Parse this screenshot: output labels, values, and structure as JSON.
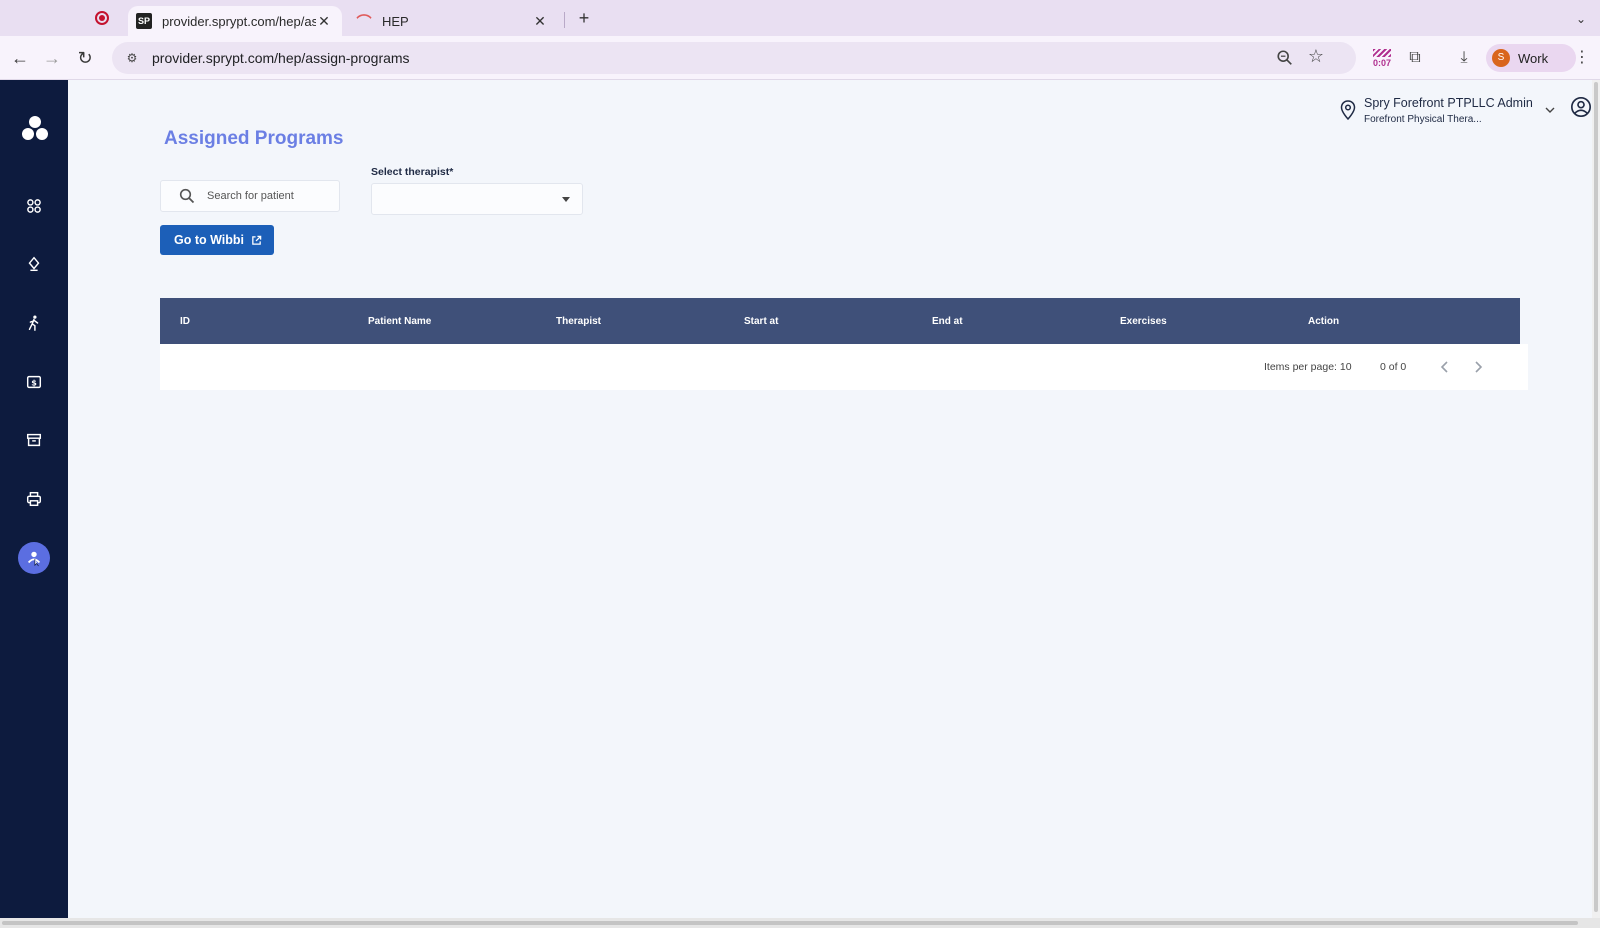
{
  "browser": {
    "tabs": [
      {
        "title": "provider.sprypt.com/hep/assi",
        "favicon": "spry-logo-icon",
        "active": true
      },
      {
        "title": "HEP",
        "favicon": "hep-icon",
        "active": false
      }
    ],
    "url": "provider.sprypt.com/hep/assign-programs",
    "extension_timer": "0:07",
    "profile": {
      "initial": "S",
      "label": "Work",
      "color": "#d9651c"
    }
  },
  "sidebar": {
    "items": [
      {
        "icon": "dashboard-icon"
      },
      {
        "icon": "diamond-pin-icon"
      },
      {
        "icon": "walking-person-icon"
      },
      {
        "icon": "billing-icon"
      },
      {
        "icon": "archive-icon"
      },
      {
        "icon": "printer-icon"
      },
      {
        "icon": "hep-exercise-icon",
        "active": true
      }
    ],
    "background": "#0d1b3e",
    "active_color": "#5b6ee1"
  },
  "header": {
    "location_name": "Spry Forefront PTPLLC Admin",
    "location_sub": "Forefront Physical Thera..."
  },
  "page": {
    "title": "Assigned Programs",
    "search_placeholder": "Search for patient",
    "therapist_label": "Select therapist*",
    "therapist_value": "",
    "wibbi_button": "Go to Wibbi"
  },
  "table": {
    "columns": [
      "ID",
      "Patient Name",
      "Therapist",
      "Start at",
      "End at",
      "Exercises",
      "Action"
    ],
    "rows": [],
    "header_color": "#3f5079"
  },
  "paginator": {
    "items_per_page": "Items per page: 10",
    "range": "0 of 0"
  },
  "colors": {
    "accent": "#6b7fe4",
    "button": "#1c5fb8"
  }
}
